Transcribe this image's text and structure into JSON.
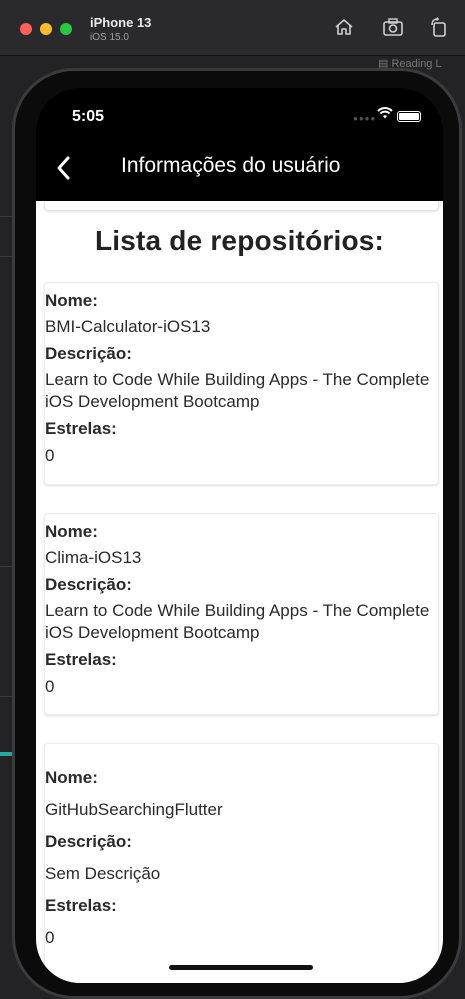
{
  "simulator": {
    "device_name": "iPhone 13",
    "os_version": "iOS 15.0",
    "reading_list": "Reading L",
    "icons": [
      "home-icon",
      "screenshot-icon",
      "rotate-icon"
    ]
  },
  "status_bar": {
    "time": "5:05",
    "icons": [
      "signal-icon",
      "wifi-icon",
      "battery-icon"
    ]
  },
  "navbar": {
    "title": "Informações do usuário",
    "back_icon": "chevron-left-icon"
  },
  "list": {
    "heading": "Lista de repositórios:",
    "labels": {
      "name": "Nome:",
      "description": "Descrição:",
      "stars": "Estrelas:"
    },
    "repos": [
      {
        "name": "BMI-Calculator-iOS13",
        "description": "Learn to Code While Building Apps - The Complete iOS Development Bootcamp",
        "stars": "0"
      },
      {
        "name": "Clima-iOS13",
        "description": "Learn to Code While Building Apps - The Complete iOS Development Bootcamp",
        "stars": "0"
      },
      {
        "name": "GitHubSearchingFlutter",
        "description": "Sem Descrição",
        "stars": "0"
      }
    ]
  }
}
